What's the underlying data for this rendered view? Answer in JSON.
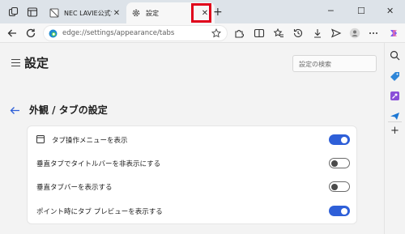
{
  "browser": {
    "tabs": [
      {
        "title": "NEC LAVIE公式サ"
      },
      {
        "title": "設定"
      }
    ],
    "address_url": "edge://settings/appearance/tabs"
  },
  "settings": {
    "page_title": "設定",
    "search_placeholder": "設定の検索",
    "section_title": "外観 / タブの設定",
    "options": [
      {
        "label": "タブ操作メニューを表示",
        "enabled": true
      },
      {
        "label": "垂直タブでタイトルバーを非表示にする",
        "enabled": false
      },
      {
        "label": "垂直タブバーを表示する",
        "enabled": false
      },
      {
        "label": "ポイント時にタブ プレビューを表示する",
        "enabled": true
      }
    ]
  },
  "colors": {
    "accent": "#2e5fd8",
    "highlight": "#e0001b"
  }
}
